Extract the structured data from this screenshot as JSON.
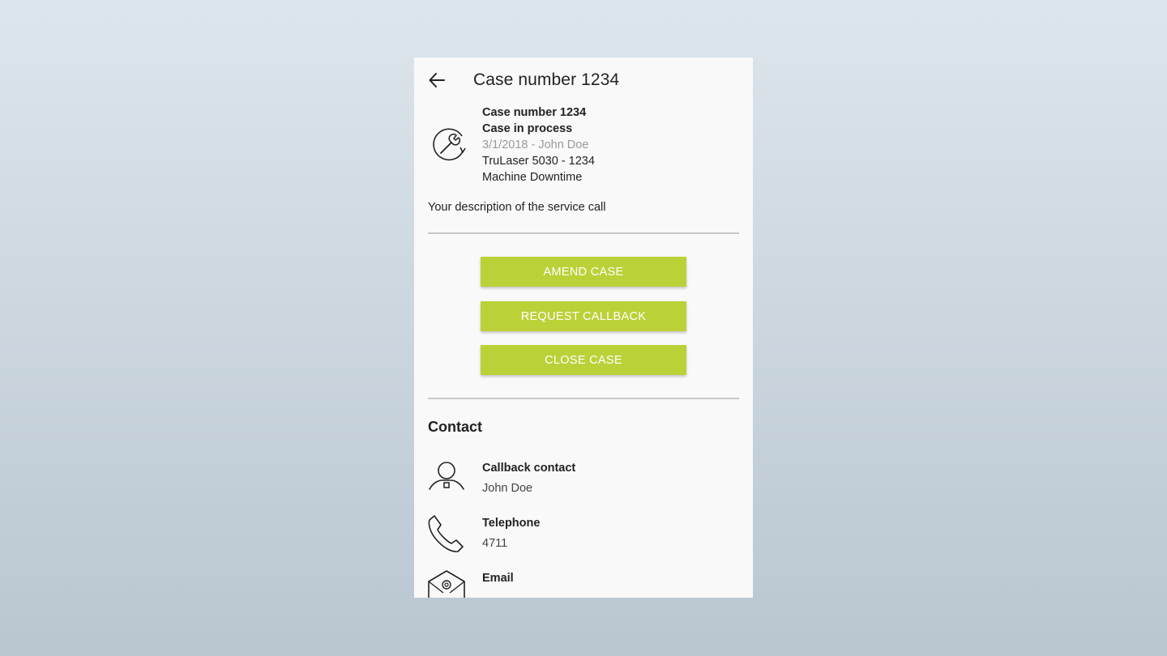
{
  "appbar": {
    "title": "Case number 1234",
    "back_icon": "arrow-left-icon"
  },
  "case": {
    "icon": "wrench-cycle-icon",
    "number": "Case number 1234",
    "status": "Case in process",
    "date_author": "3/1/2018 - John Doe",
    "machine": "TruLaser 5030 - 1234",
    "issue": "Machine Downtime",
    "description": "Your description of the service call"
  },
  "actions": {
    "amend_label": "AMEND CASE",
    "callback_label": "REQUEST CALLBACK",
    "close_label": "CLOSE CASE",
    "button_color": "#bbd137"
  },
  "contact": {
    "heading": "Contact",
    "callback": {
      "icon": "person-icon",
      "label": "Callback contact",
      "value": "John Doe"
    },
    "telephone": {
      "icon": "phone-icon",
      "label": "Telephone",
      "value": "4711"
    },
    "email": {
      "icon": "email-icon",
      "label": "Email"
    }
  }
}
